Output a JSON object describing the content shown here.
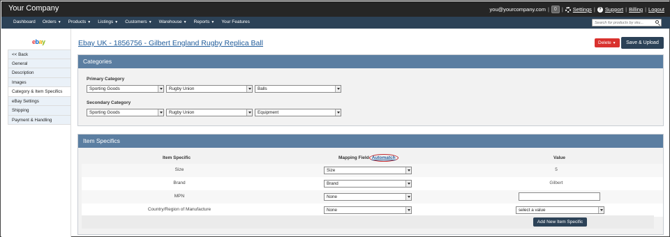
{
  "header": {
    "company": "Your Company",
    "email": "you@yourcompany.com",
    "count": "0",
    "settings": "Settings",
    "support": "Support",
    "billing": "Billing",
    "logout": "Logout"
  },
  "nav": {
    "items": [
      "Dashboard",
      "Orders",
      "Products",
      "Listings",
      "Customers",
      "Warehouse",
      "Reports",
      "Your Features"
    ],
    "search_placeholder": "Search for products by sku..."
  },
  "sidebar": {
    "logo": {
      "e": "e",
      "b": "b",
      "a": "a",
      "y": "y"
    },
    "items": [
      "<< Back",
      "General",
      "Description",
      "Images",
      "Category & Item Specifics",
      "eBay Settings",
      "Shipping",
      "Payment & Handling"
    ]
  },
  "page": {
    "title": "Ebay UK - 1856756 - Gilbert England Rugby Replica Ball",
    "delete_label": "Delete",
    "save_label": "Save & Upload"
  },
  "categories": {
    "heading": "Categories",
    "primary_label": "Primary Category",
    "primary": [
      "Sporting Goods",
      "Rugby Union",
      "Balls"
    ],
    "secondary_label": "Secondary Category",
    "secondary": [
      "Sporting Goods",
      "Rugby Union",
      "Equipment"
    ]
  },
  "item_specifics": {
    "heading": "Item Specifics",
    "col_specific": "Item Specific",
    "col_mapping": "Mapping Field",
    "automatch": "Automatch",
    "col_value": "Value",
    "rows": [
      {
        "name": "Size",
        "mapping": "Size",
        "value": "5"
      },
      {
        "name": "Brand",
        "mapping": "Brand",
        "value": "Gilbert"
      },
      {
        "name": "MPN",
        "mapping": "None",
        "value": ""
      },
      {
        "name": "Country/Region of Manufacture",
        "mapping": "None",
        "value": "select a value"
      }
    ],
    "add_label": "Add New Item Specific"
  }
}
